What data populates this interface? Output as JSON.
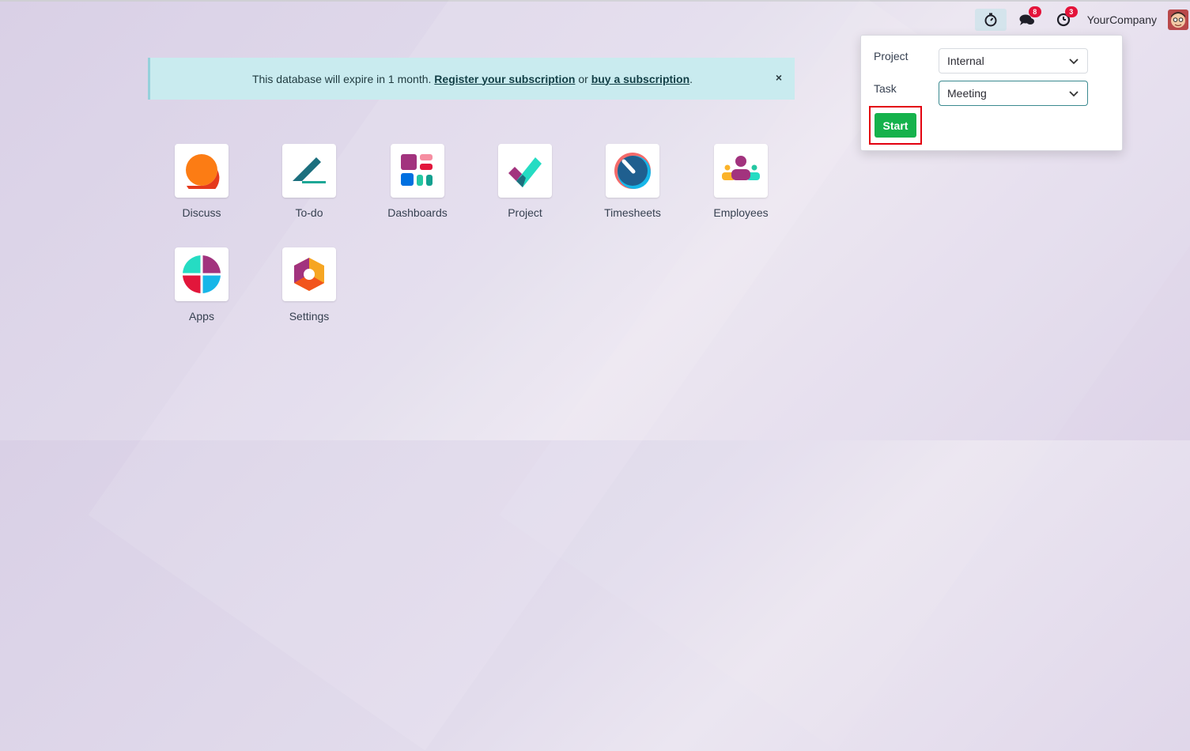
{
  "navbar": {
    "timer_icon": "stopwatch-icon",
    "messages": {
      "icon": "chat-bubbles-icon",
      "count": "8"
    },
    "activities": {
      "icon": "clock-icon",
      "count": "3"
    },
    "company": "YourCompany",
    "avatar_icon": "user-avatar"
  },
  "alert": {
    "text_before": "This database will expire in 1 month. ",
    "link1": "Register your subscription",
    "text_mid": " or ",
    "link2": "buy a subscription",
    "text_after": ".",
    "close": "×"
  },
  "apps": [
    {
      "label": "Discuss",
      "icon": "discuss-icon"
    },
    {
      "label": "To-do",
      "icon": "todo-icon"
    },
    {
      "label": "Dashboards",
      "icon": "dashboards-icon"
    },
    {
      "label": "Project",
      "icon": "project-icon"
    },
    {
      "label": "Timesheets",
      "icon": "timesheets-icon"
    },
    {
      "label": "Employees",
      "icon": "employees-icon"
    },
    {
      "label": "Apps",
      "icon": "apps-icon"
    },
    {
      "label": "Settings",
      "icon": "settings-icon"
    }
  ],
  "timer_popup": {
    "project_label": "Project",
    "project_value": "Internal",
    "task_label": "Task",
    "task_value": "Meeting",
    "start_label": "Start"
  },
  "colors": {
    "accent_green": "#15b24c",
    "badge_red": "#e4133a",
    "highlight_red": "#e3000f",
    "alert_bg": "#c9ebef"
  }
}
